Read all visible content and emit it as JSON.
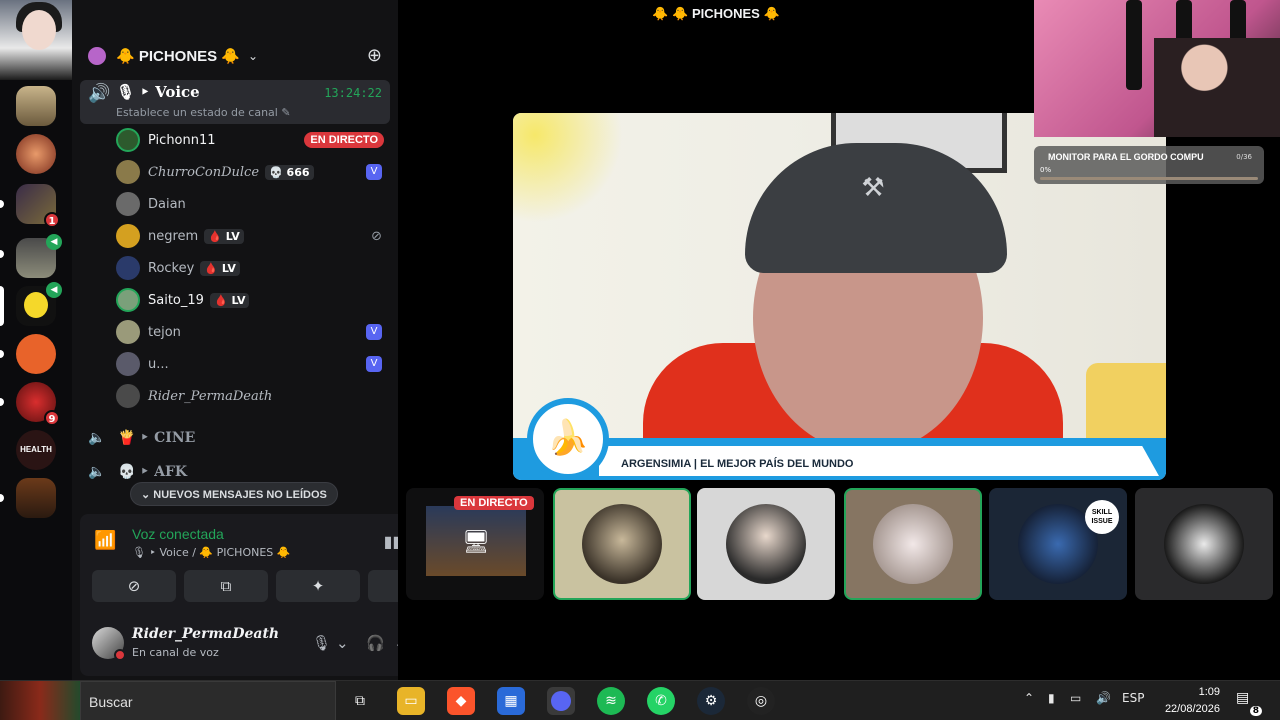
{
  "window": {
    "title": "🐥 🐥 PICHONES 🐥"
  },
  "server": {
    "name": "🐥 PICHONES 🐥"
  },
  "voice_channel": {
    "name": "🎙 ‣ Voice",
    "timer": "13:24:22",
    "status_placeholder": "Establece un estado de canal ✎"
  },
  "members": [
    {
      "name": "Pichonn11",
      "live": "EN DIRECTO"
    },
    {
      "name": "ChurroConDulce",
      "tag": "💀 666",
      "vbadge": "V"
    },
    {
      "name": "Daian"
    },
    {
      "name": "negrem",
      "tag": "🩸 LV"
    },
    {
      "name": "Rockey",
      "tag": "🩸 LV"
    },
    {
      "name": "Saito_19",
      "tag": "🩸 LV"
    },
    {
      "name": "tejon",
      "vbadge": "V"
    },
    {
      "name": "u...",
      "vbadge": "V"
    },
    {
      "name": "Rider_PermaDeath"
    }
  ],
  "channels": [
    {
      "name": "🍟 ‣ CINE"
    },
    {
      "name": "💀 ‣ AFK"
    }
  ],
  "new_messages": "NUEVOS MENSAJES NO LEÍDOS",
  "voice_panel": {
    "status": "Voz conectada",
    "location": "🎙 ‣ Voice / 🐥 PICHONES 🐥"
  },
  "user": {
    "name": "Rider_PermaDeath",
    "status": "En canal de voz"
  },
  "guild_badges": {
    "g3": "1",
    "g7": "9"
  },
  "health_label": "HEALTH",
  "stream": {
    "lower_third": "ARGENSIMIA | EL MEJOR PAÍS DEL MUNDO",
    "cap_logo": "⚒"
  },
  "goal": {
    "title": "MONITOR PARA EL GORDO COMPU",
    "count": "0/36",
    "progress_label": "0%",
    "progress": 0
  },
  "tiles": [
    {
      "live": "EN DIRECTO"
    },
    {},
    {},
    {},
    {
      "skill": "SKILL ISSUE"
    },
    {}
  ],
  "taskbar": {
    "search": "Buscar",
    "lang": "ESP",
    "time": "1:09",
    "date": "22/08/2026",
    "notifications": "8"
  },
  "colors": {
    "accent_green": "#23a559",
    "live_red": "#da373c",
    "blurple": "#5865f2"
  }
}
